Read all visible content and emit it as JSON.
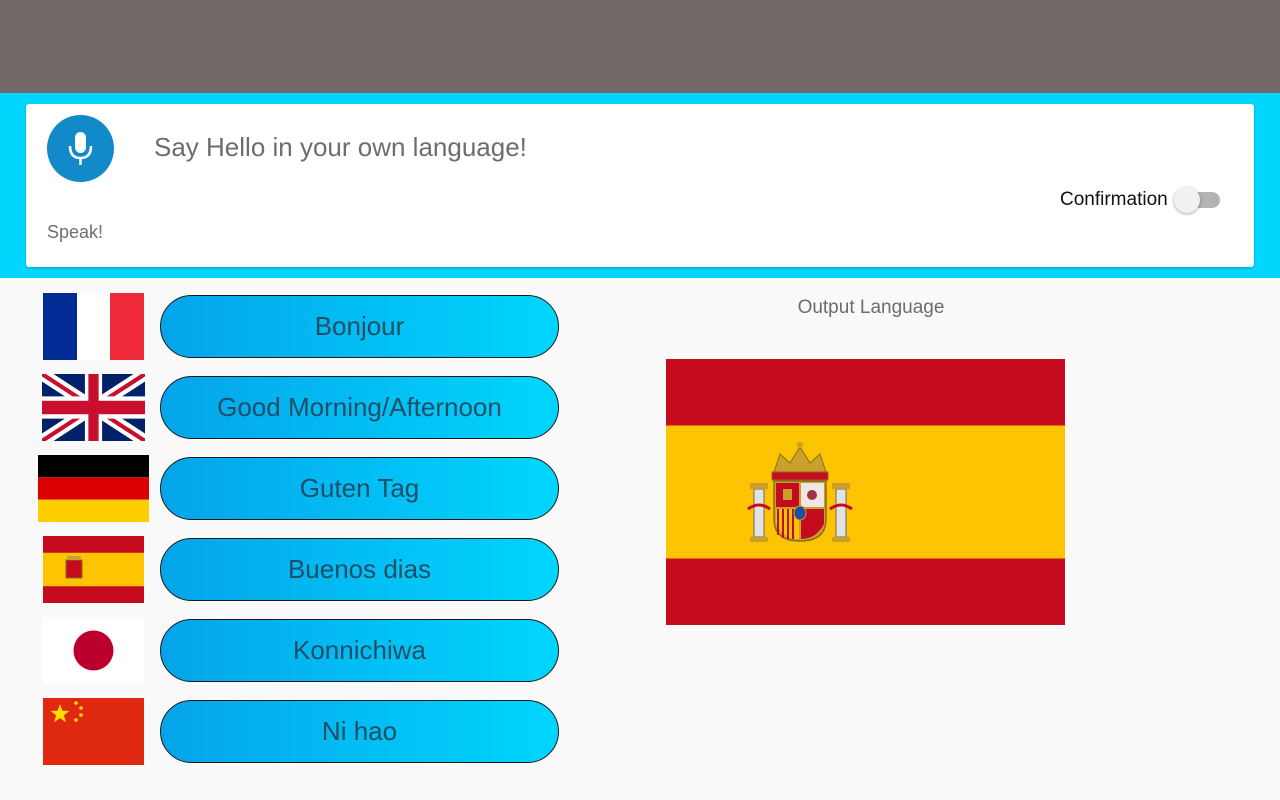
{
  "header": {
    "mic_icon": "microphone-icon",
    "speak_label": "Speak!",
    "prompt": "Say Hello in your own language!",
    "confirmation_label": "Confirmation",
    "confirmation_enabled": false
  },
  "languages": [
    {
      "flag": "france-flag",
      "label": "Bonjour"
    },
    {
      "flag": "uk-flag",
      "label": "Good Morning/Afternoon"
    },
    {
      "flag": "germany-flag",
      "label": "Guten Tag"
    },
    {
      "flag": "spain-flag",
      "label": "Buenos dias"
    },
    {
      "flag": "japan-flag",
      "label": "Konnichiwa"
    },
    {
      "flag": "china-flag",
      "label": "Ni hao"
    }
  ],
  "output": {
    "label": "Output Language",
    "selected_flag": "spain-flag"
  },
  "colors": {
    "status_bar": "#716867",
    "accent": "#00d6fb",
    "mic_button": "#1289c9",
    "button_gradient_start": "#05a4ea",
    "button_gradient_end": "#00d6fd"
  }
}
